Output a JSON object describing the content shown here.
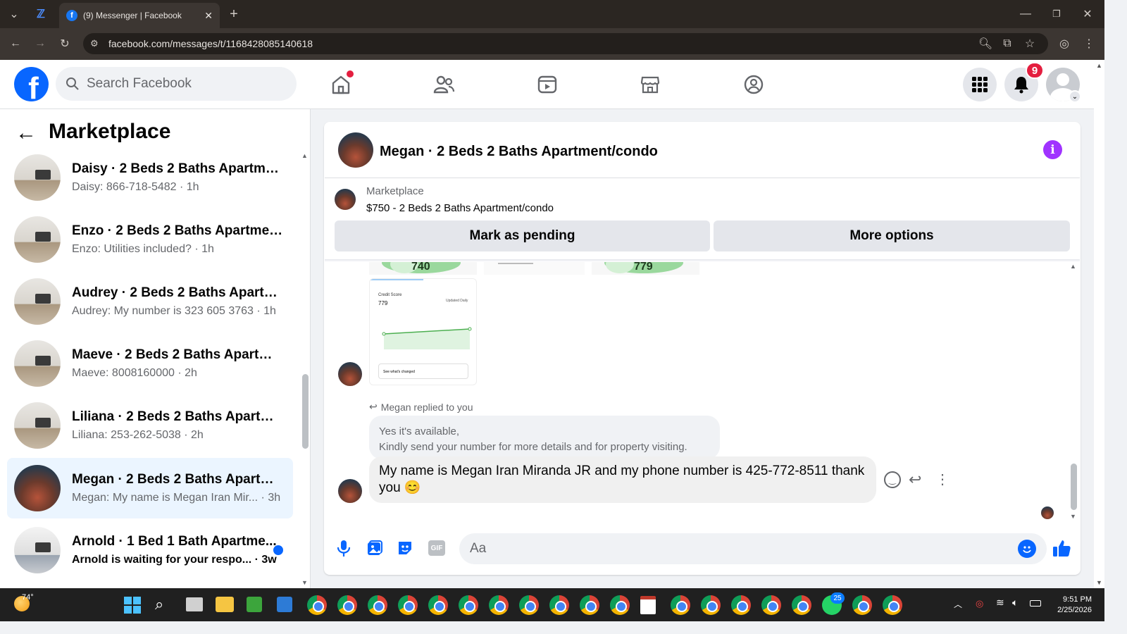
{
  "browser": {
    "tab_title": "(9) Messenger | Facebook",
    "url": "facebook.com/messages/t/1168428085140618"
  },
  "header": {
    "search_placeholder": "Search Facebook",
    "notification_count": "9"
  },
  "sidebar": {
    "title": "Marketplace",
    "conversations": [
      {
        "title": "Daisy · 2 Beds 2 Baths Apartmen...",
        "preview": "Daisy: 866-718-5482 · 1h"
      },
      {
        "title": "Enzo · 2 Beds 2 Baths Apartment...",
        "preview": "Enzo: Utilities included? · 1h"
      },
      {
        "title": "Audrey · 2 Beds 2 Baths Apartme...",
        "preview": "Audrey: My number is 323 605 3763 · 1h"
      },
      {
        "title": "Maeve · 2 Beds 2 Baths Apartme...",
        "preview": "Maeve: 8008160000 · 2h"
      },
      {
        "title": "Liliana · 2 Beds 2 Baths Apartme...",
        "preview": "Liliana: 253-262-5038 · 2h"
      },
      {
        "title": "Megan · 2 Beds 2 Baths Apartme...",
        "preview": "Megan: My name is Megan Iran Mir... · 3h"
      },
      {
        "title": "Arnold · 1 Bed 1 Bath Apartme...",
        "preview": "Arnold is waiting for your respo... · 3w"
      }
    ]
  },
  "chat": {
    "title": "Megan · 2 Beds 2 Baths Apartment/condo",
    "listing_source": "Marketplace",
    "listing_title": "$750 - 2 Beds 2 Baths Apartment/condo",
    "mark_pending_label": "Mark as pending",
    "more_options_label": "More options",
    "credit_score_left": "740",
    "credit_score_right": "779",
    "chart_label": "Credit Score",
    "chart_value": "779",
    "chart_updated": "Updated Daily",
    "chart_button": "See what's changed",
    "reply_label": "Megan replied to you",
    "quoted_line1": "Yes it's available,",
    "quoted_line2": "Kindly send your number for more details and for property visiting.",
    "message_text": "My name is Megan Iran Miranda JR and my phone number is 425-772-8511 thank you 😊",
    "composer_placeholder": "Aa"
  },
  "taskbar": {
    "weather_temp": "74°",
    "time": "9:51 PM",
    "date": "2/25/2026",
    "whatsapp_badge": "25"
  },
  "colors": {
    "fb_blue": "#0866ff",
    "info_purple": "#a033ff",
    "browser_dark": "#2b2622"
  }
}
